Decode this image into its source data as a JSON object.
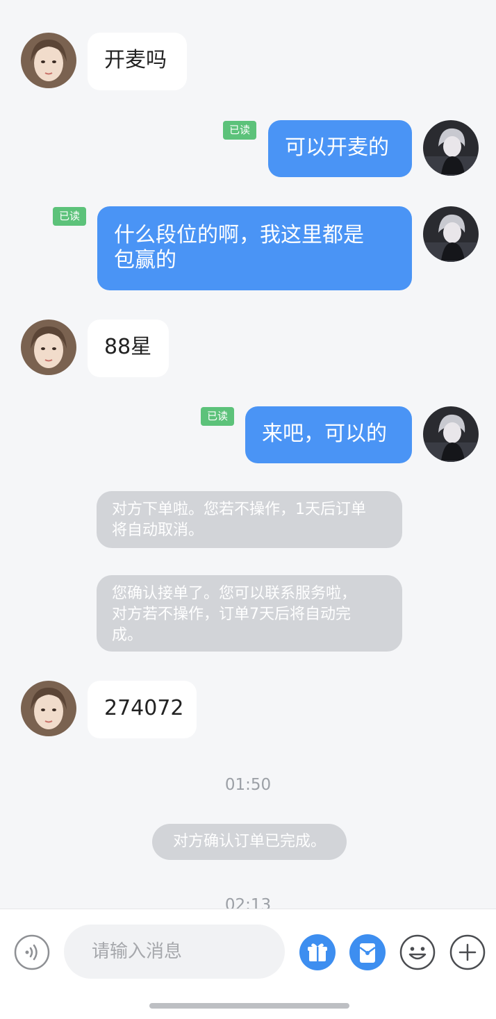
{
  "messages": [
    {
      "text": "开麦吗"
    },
    {
      "text": "可以开麦的",
      "badge": "已读"
    },
    {
      "line1": "什么段位的啊，我这里都是",
      "line2": "包赢的",
      "badge": "已读"
    },
    {
      "text": "88星"
    },
    {
      "text": "来吧，可以的",
      "badge": "已读"
    },
    {
      "line1": "对方下单啦。您若不操作，1天后订单",
      "line2": "将自动取消。"
    },
    {
      "line1": "您确认接单了。您可以联系服务啦，",
      "line2": "对方若不操作，订单7天后将自动完",
      "line3": "成。"
    },
    {
      "text": "274072"
    },
    {
      "time": "01:50"
    },
    {
      "text": "对方确认订单已完成。"
    },
    {
      "time": "02:13"
    }
  ],
  "input": {
    "placeholder": "请输入消息"
  },
  "icons": [
    "voice-icon",
    "gift-icon",
    "red-envelope-icon",
    "emoji-icon",
    "add-icon"
  ],
  "colors": {
    "accent": "#4a94f5",
    "read_badge": "#5cc27a",
    "system_bubble": "#d2d4d8",
    "background": "#f5f6f8"
  }
}
